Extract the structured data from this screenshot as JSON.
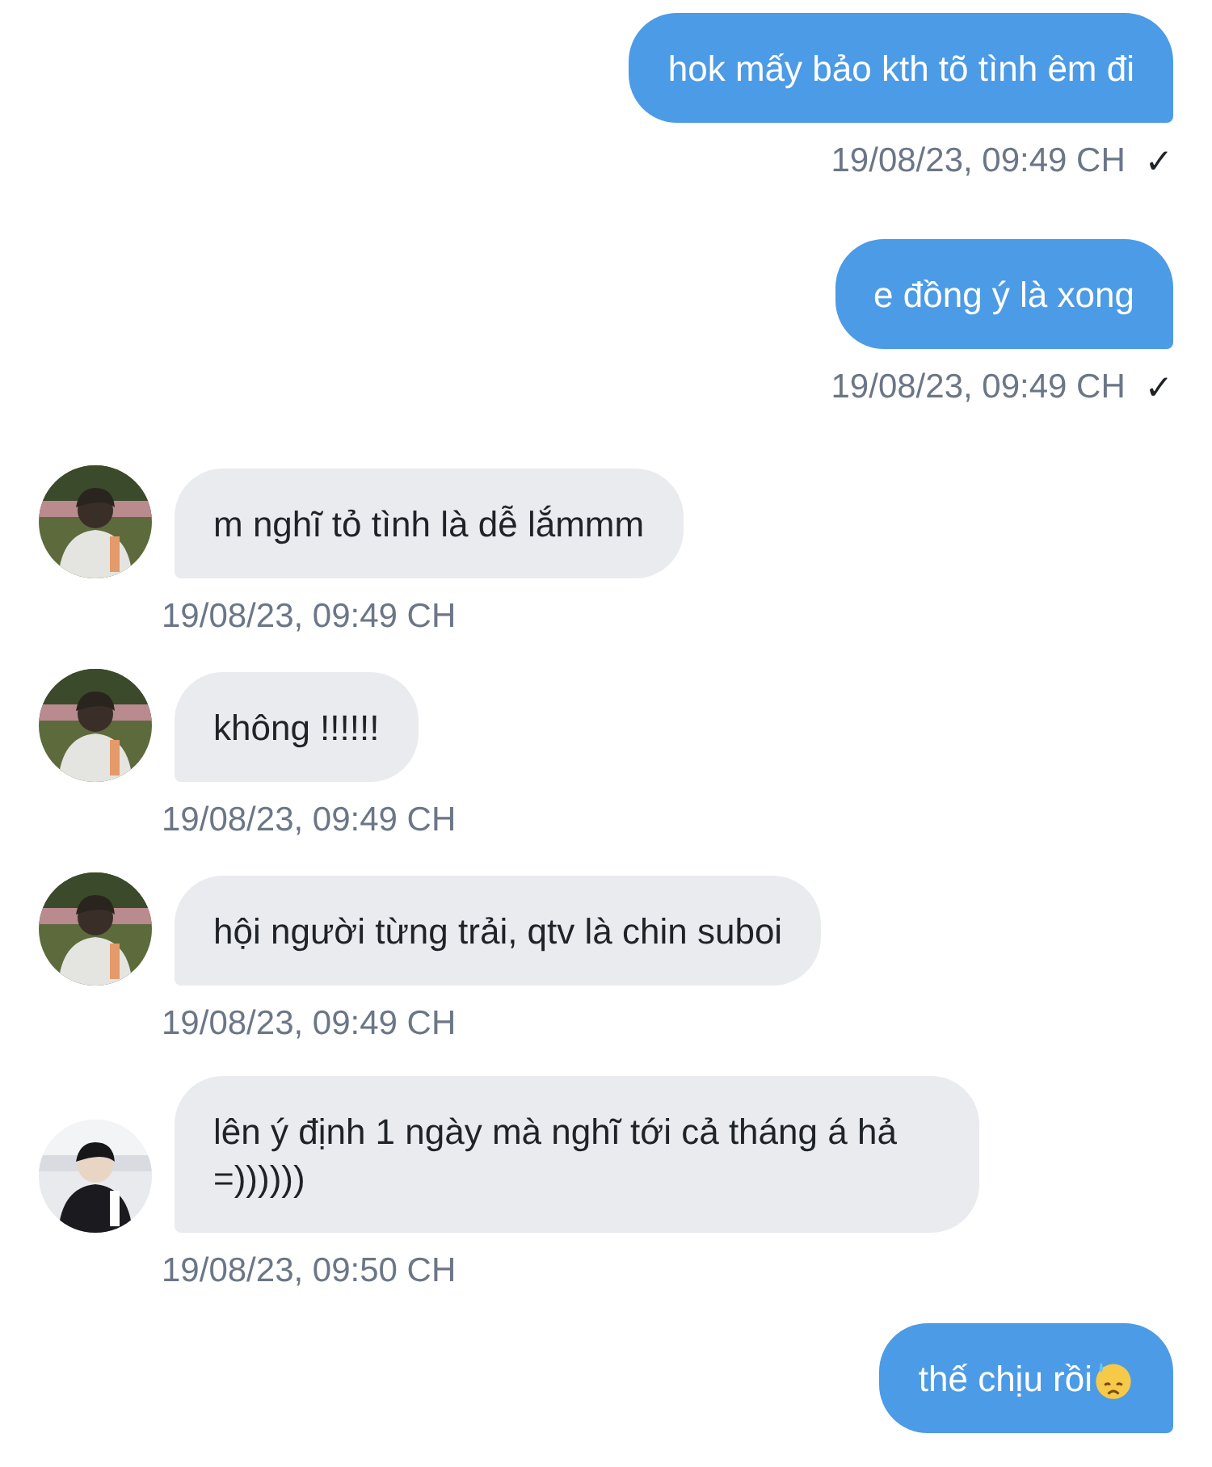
{
  "messages": [
    {
      "kind": "outgoing",
      "text": "hok mấy bảo kth tõ tình êm đi",
      "time": "19/08/23, 09:49 CH",
      "tick": "✓"
    },
    {
      "kind": "outgoing",
      "text": "e đồng ý là xong",
      "time": "19/08/23, 09:49 CH",
      "tick": "✓"
    },
    {
      "kind": "incoming",
      "text": "m nghĩ tỏ tình là dễ lắmmm",
      "time": "19/08/23, 09:49 CH"
    },
    {
      "kind": "incoming",
      "text": "không !!!!!!",
      "time": "19/08/23, 09:49 CH"
    },
    {
      "kind": "incoming",
      "text": "hội người từng trải, qtv là chin suboi",
      "time": "19/08/23, 09:49 CH"
    },
    {
      "kind": "incoming",
      "text": "lên ý định 1 ngày mà nghĩ tới cả tháng á hả =))))))",
      "time": "19/08/23, 09:50 CH"
    },
    {
      "kind": "outgoing",
      "text": "thế chịu rồi",
      "trailing": {
        "kind": "sweat-face"
      }
    }
  ]
}
